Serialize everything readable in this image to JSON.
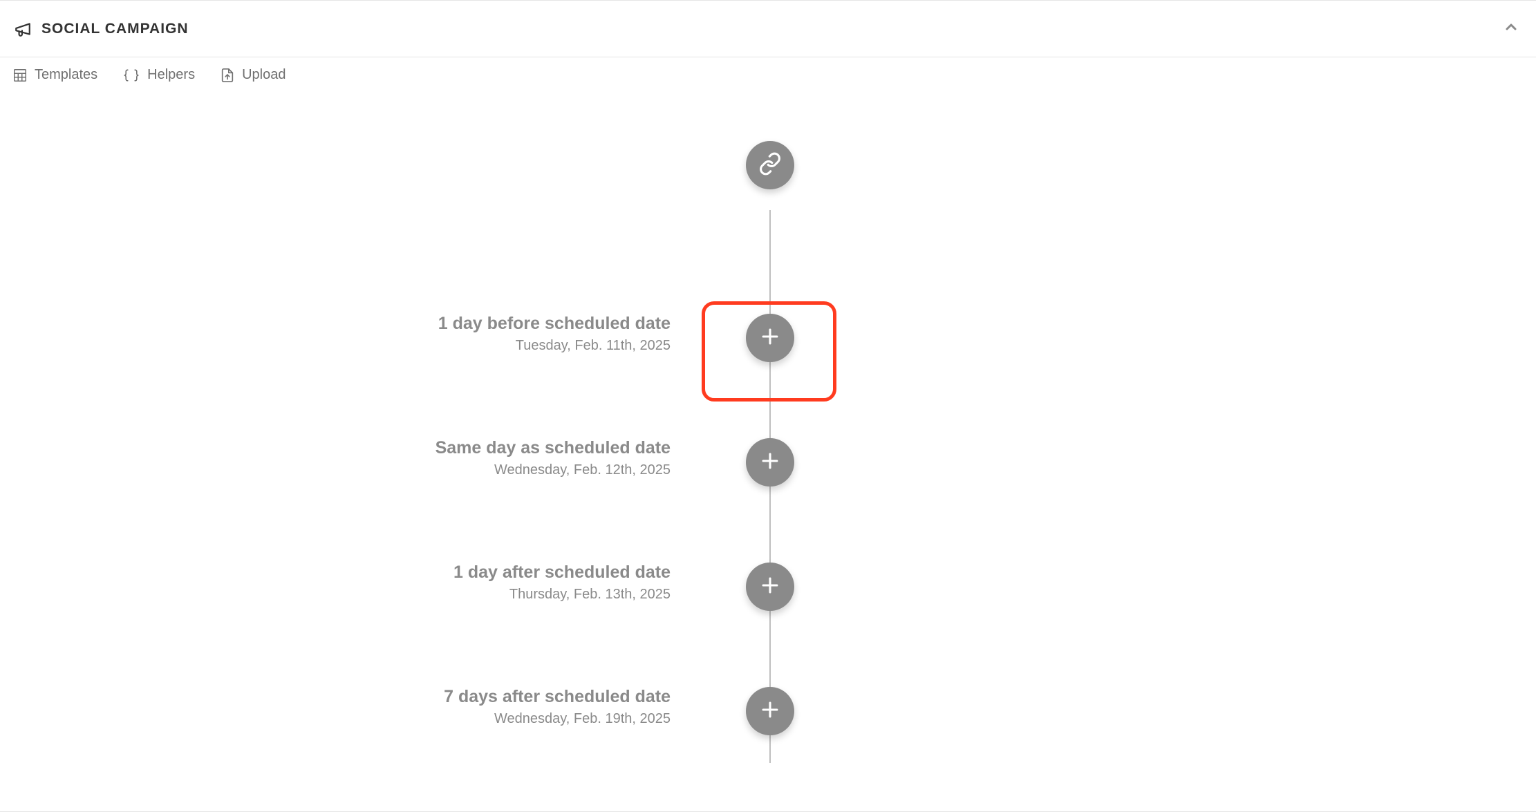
{
  "panel": {
    "title": "SOCIAL CAMPAIGN"
  },
  "toolbar": {
    "templates": "Templates",
    "helpers": "Helpers",
    "upload": "Upload"
  },
  "timeline": {
    "rows": [
      {
        "title": "1 day before scheduled date",
        "date": "Tuesday, Feb. 11th, 2025"
      },
      {
        "title": "Same day as scheduled date",
        "date": "Wednesday, Feb. 12th, 2025"
      },
      {
        "title": "1 day after scheduled date",
        "date": "Thursday, Feb. 13th, 2025"
      },
      {
        "title": "7 days after scheduled date",
        "date": "Wednesday, Feb. 19th, 2025"
      }
    ]
  }
}
